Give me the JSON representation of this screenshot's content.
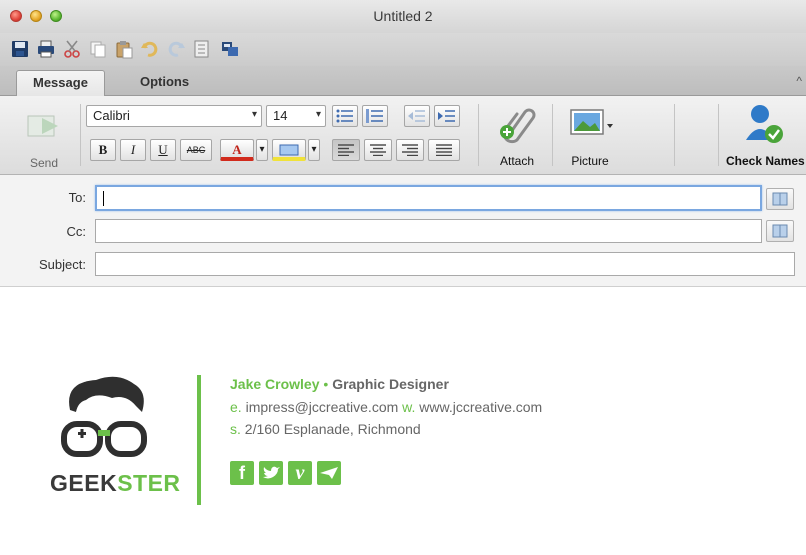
{
  "window": {
    "title": "Untitled 2"
  },
  "tabs": [
    {
      "label": "Message",
      "active": true
    },
    {
      "label": "Options",
      "active": false
    }
  ],
  "ribbon": {
    "send_label": "Send",
    "font_name": "Calibri",
    "font_size": "14",
    "bold": "B",
    "italic": "I",
    "underline": "U",
    "strike": "ABC",
    "font_color_letter": "A",
    "attach_label": "Attach",
    "picture_label": "Picture",
    "check_names_label": "Check Names"
  },
  "fields": {
    "to_label": "To:",
    "to_value": "",
    "cc_label": "Cc:",
    "cc_value": "",
    "subject_label": "Subject:",
    "subject_value": ""
  },
  "signature": {
    "name": "Jake Crowley",
    "bullet": "•",
    "title": "Graphic Designer",
    "email_prefix": "e.",
    "email": "impress@jccreative.com",
    "web_prefix": "w.",
    "web": "www.jccreative.com",
    "address_prefix": "s.",
    "address": "2/160 Esplanade, Richmond",
    "brand_part1": "GEEK",
    "brand_part2": "STER",
    "social": [
      {
        "icon": "facebook-icon",
        "glyph": "f"
      },
      {
        "icon": "twitter-icon",
        "glyph": "t"
      },
      {
        "icon": "vimeo-icon",
        "glyph": "v"
      },
      {
        "icon": "behance-icon",
        "glyph": "b"
      }
    ]
  },
  "colors": {
    "accent_green": "#6cc04a",
    "focus_blue": "#7aa7e0",
    "flag_red": "#d93a2b"
  }
}
